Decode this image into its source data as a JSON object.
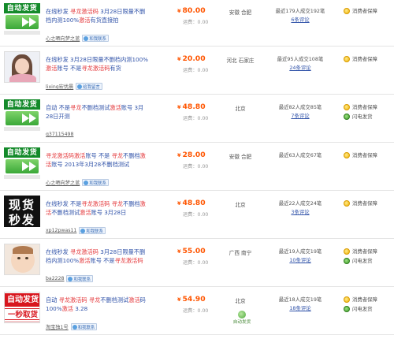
{
  "colors": {
    "price": "#ff5500",
    "highlight": "#e4393c",
    "title": "#3355aa",
    "auto_green": "#148a2a",
    "red_banner": "#d8161e"
  },
  "listings": [
    {
      "thumb": "auto",
      "thumb_text": "自动发货",
      "title": [
        {
          "t": "在线秒发 "
        },
        {
          "t": "寻龙激活码",
          "hl": true
        },
        {
          "t": " 3月28日限量不删档内测100%"
        },
        {
          "t": "激活",
          "hl": true
        },
        {
          "t": "有货直接拍"
        }
      ],
      "seller": "心之晒向梦之蓝",
      "contact": "和我联系",
      "price": "80.00",
      "shipping": "运费：0.00",
      "location": "安徽 合肥",
      "sales": "最近179人成交192笔",
      "reviews": "6条评论",
      "services": [
        "消费者保障"
      ],
      "auto_ship": null
    },
    {
      "thumb": "girl",
      "thumb_text": "",
      "title": [
        {
          "t": "在线秒发 3月28日限量不删档内测100%"
        },
        {
          "t": "激活",
          "hl": true
        },
        {
          "t": "账号 不是"
        },
        {
          "t": "寻龙激活码",
          "hl": true
        },
        {
          "t": "有货"
        }
      ],
      "seller": "lixing宏优晨",
      "contact": "给我留言",
      "price": "20.00",
      "shipping": "运费：0.00",
      "location": "河北 石家庄",
      "sales": "最近95人成交108笔",
      "reviews": "24条评论",
      "services": [
        "消费者保障"
      ],
      "auto_ship": null
    },
    {
      "thumb": "auto",
      "thumb_text": "自动发货",
      "title": [
        {
          "t": "自动 不是"
        },
        {
          "t": "寻龙",
          "hl": true
        },
        {
          "t": "不删档测试"
        },
        {
          "t": "激活",
          "hl": true
        },
        {
          "t": "账号 3月28日开测"
        }
      ],
      "seller": "q37115498",
      "contact": "",
      "price": "48.80",
      "shipping": "运费：0.00",
      "location": "北京",
      "sales": "最近82人成交85笔",
      "reviews": "7条评论",
      "services": [
        "消费者保障",
        "闪电发货"
      ],
      "auto_ship": null
    },
    {
      "thumb": "auto",
      "thumb_text": "自动发货",
      "title": [
        {
          "t": "寻龙激活码激活",
          "hl": true
        },
        {
          "t": "账号 不是 "
        },
        {
          "t": "寻龙",
          "hl": true
        },
        {
          "t": "不删档"
        },
        {
          "t": "激活",
          "hl": true
        },
        {
          "t": "账号 2013年3月28不删档测试"
        }
      ],
      "seller": "心之晒向梦之蓝",
      "contact": "和我联系",
      "price": "28.00",
      "shipping": "运费：0.00",
      "location": "安徽 合肥",
      "sales": "最近63人成交67笔",
      "reviews": "",
      "services": [
        "消费者保障"
      ],
      "auto_ship": null
    },
    {
      "thumb": "xianhuo",
      "thumb_text": [
        "现货",
        "秒发"
      ],
      "title": [
        {
          "t": "在线秒发 不是"
        },
        {
          "t": "寻龙激活码",
          "hl": true
        },
        {
          "t": " 寻龙",
          "hl": true
        },
        {
          "t": "不删档"
        },
        {
          "t": "激活",
          "hl": true
        },
        {
          "t": "不删档测试"
        },
        {
          "t": "激活",
          "hl": true
        },
        {
          "t": "账号 3月28日"
        }
      ],
      "seller": "xp12pwas11",
      "contact": "和我联系",
      "price": "48.80",
      "shipping": "运费：0.00",
      "location": "北京",
      "sales": "最近22人成交24笔",
      "reviews": "3条评论",
      "services": [
        "消费者保障"
      ],
      "auto_ship": null
    },
    {
      "thumb": "baby",
      "thumb_text": "",
      "title": [
        {
          "t": "在线秒发 "
        },
        {
          "t": "寻龙激活码",
          "hl": true
        },
        {
          "t": " 3月28日限量不删档内测100%"
        },
        {
          "t": "激活",
          "hl": true
        },
        {
          "t": "账号 不是"
        },
        {
          "t": "寻龙激活码",
          "hl": true
        }
      ],
      "seller": "ba2228",
      "contact": "和我联系",
      "price": "55.00",
      "shipping": "运费：0.00",
      "location": "广西 南宁",
      "sales": "最近19人成交19笔",
      "reviews": "10条评论",
      "services": [
        "消费者保障",
        "闪电发货"
      ],
      "auto_ship": null
    },
    {
      "thumb": "red",
      "thumb_text": [
        "自动发货",
        "一秒取货"
      ],
      "title": [
        {
          "t": "自动 "
        },
        {
          "t": "寻龙激活码",
          "hl": true
        },
        {
          "t": " 寻龙",
          "hl": true
        },
        {
          "t": "不删档测试"
        },
        {
          "t": "激活",
          "hl": true
        },
        {
          "t": "码 100%"
        },
        {
          "t": "激活",
          "hl": true
        },
        {
          "t": " 3.28"
        }
      ],
      "seller": "淘宝独1号",
      "contact": "和我联系",
      "price": "54.90",
      "shipping": "运费：0.00",
      "location": "北京",
      "sales": "最近18人成交19笔",
      "reviews": "18条评论",
      "services": [
        "消费者保障",
        "闪电发货"
      ],
      "auto_ship": "自动发货"
    }
  ]
}
